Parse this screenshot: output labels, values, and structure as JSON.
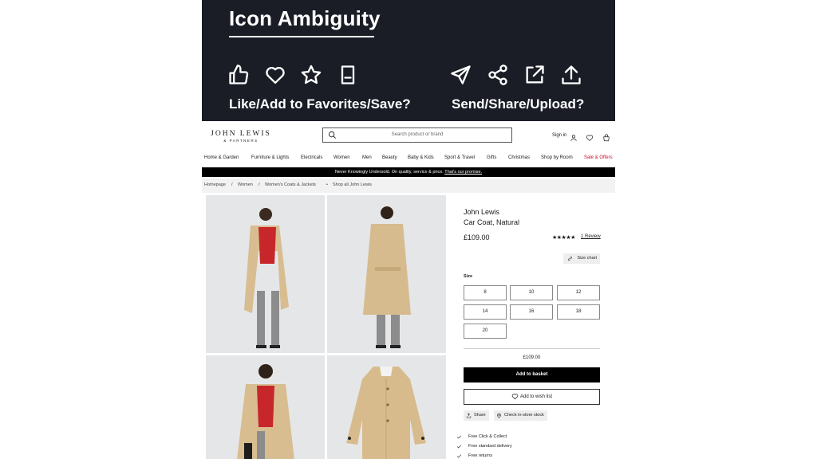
{
  "banner": {
    "title": "Icon Ambiguity",
    "left_caption": "Like/Add to Favorites/Save?",
    "right_caption": "Send/Share/Upload?",
    "icons": [
      "thumbs-up-icon",
      "heart-icon",
      "star-icon",
      "bookmark-icon",
      "paper-plane-icon",
      "share-nodes-icon",
      "external-link-icon",
      "upload-icon"
    ],
    "background": "#1a1d26"
  },
  "header": {
    "logo_main": "JOHN LEWIS",
    "logo_sub": "& PARTNERS",
    "search_placeholder": "Search product or brand",
    "sign_in": "Sign in"
  },
  "nav": {
    "items": [
      "Home & Garden",
      "Furniture & Lights",
      "Electricals",
      "Women",
      "Men",
      "Beauty",
      "Baby & Kids",
      "Sport & Travel",
      "Gifts",
      "Christmas",
      "Shop by Room",
      "Sale & Offers"
    ],
    "sale_color": "#c8102e"
  },
  "promo": {
    "text": "Never Knowingly Undersold. On quality, service & price.",
    "link": "That's our promise."
  },
  "breadcrumb": {
    "items": [
      "Homepage",
      "/",
      "Women",
      "/",
      "Women's Coats & Jackets",
      "•",
      "Shop all John Lewis"
    ]
  },
  "product": {
    "brand": "John Lewis",
    "name": "Car Coat, Natural",
    "price": "£109.00",
    "stars": "★★★★★",
    "rating_out_of_5": 5,
    "reviews": "1 Review",
    "size_chart": "Size chart",
    "size_label": "Size",
    "sizes": [
      "8",
      "10",
      "12",
      "14",
      "16",
      "18",
      "20"
    ],
    "summary_price": "£109.00",
    "add_to_basket": "Add to basket",
    "add_to_wishlist": "Add to wish list",
    "share": "Share",
    "check_stock": "Check in-store stock",
    "perks": [
      "Free Click & Collect",
      "Free standard delivery",
      "Free returns"
    ]
  }
}
